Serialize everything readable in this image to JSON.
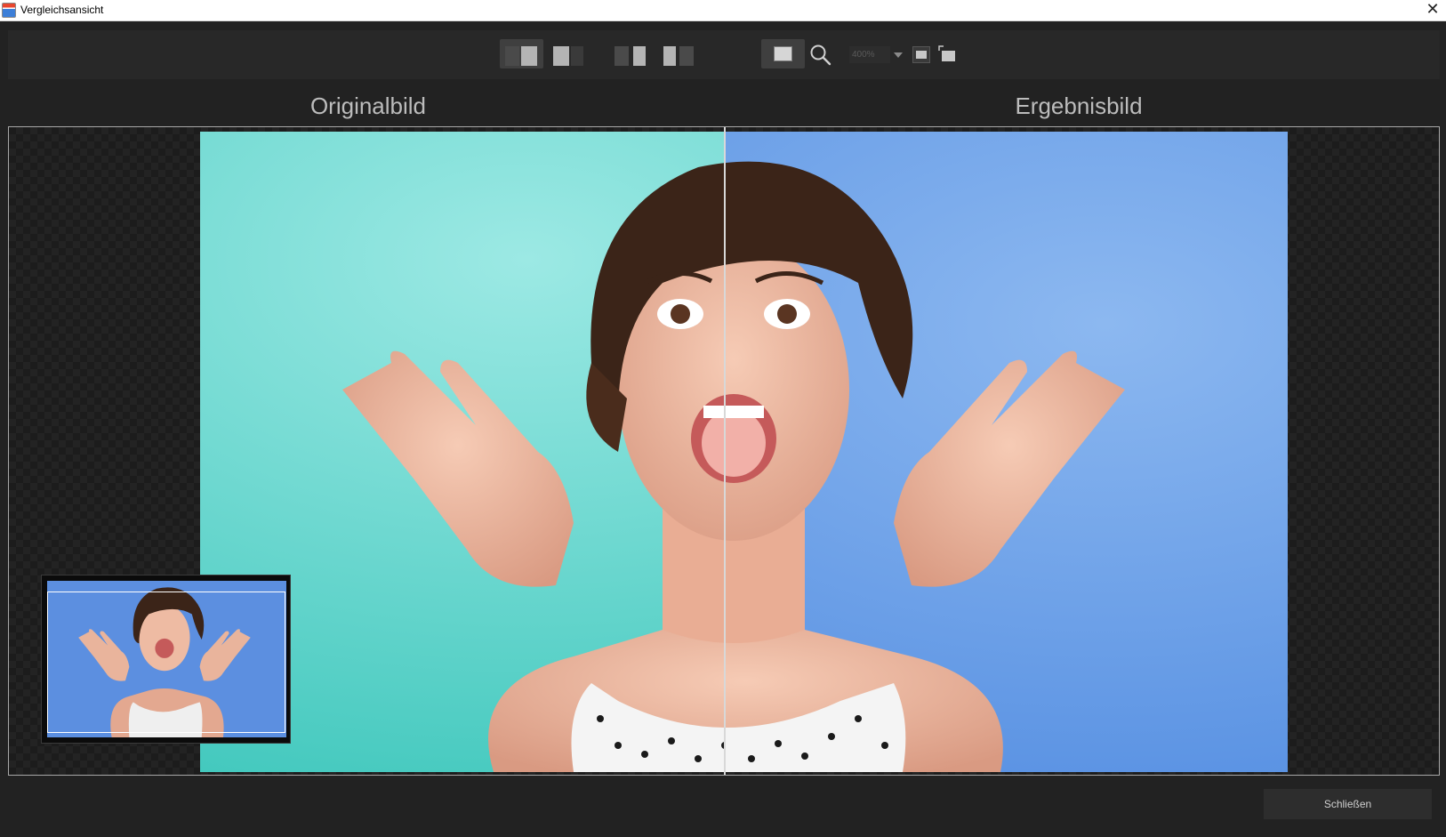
{
  "window": {
    "title": "Vergleichsansicht",
    "close_glyph": "✕"
  },
  "toolbar": {
    "view_modes": [
      "split-vertical",
      "single-original",
      "side-by-side",
      "side-by-side-alt"
    ],
    "single_view": "single-image",
    "zoom_value": "400%",
    "zoom_icon": "magnifier-icon",
    "fit_icon": "fit-to-window-icon",
    "fullscreen_icon": "fullscreen-icon"
  },
  "labels": {
    "original": "Originalbild",
    "result": "Ergebnisbild"
  },
  "colors": {
    "original_bg": "#6fd8cf",
    "result_bg": "#6e9ee8",
    "accent": "#ffffff"
  },
  "footer": {
    "close_label": "Schließen"
  }
}
